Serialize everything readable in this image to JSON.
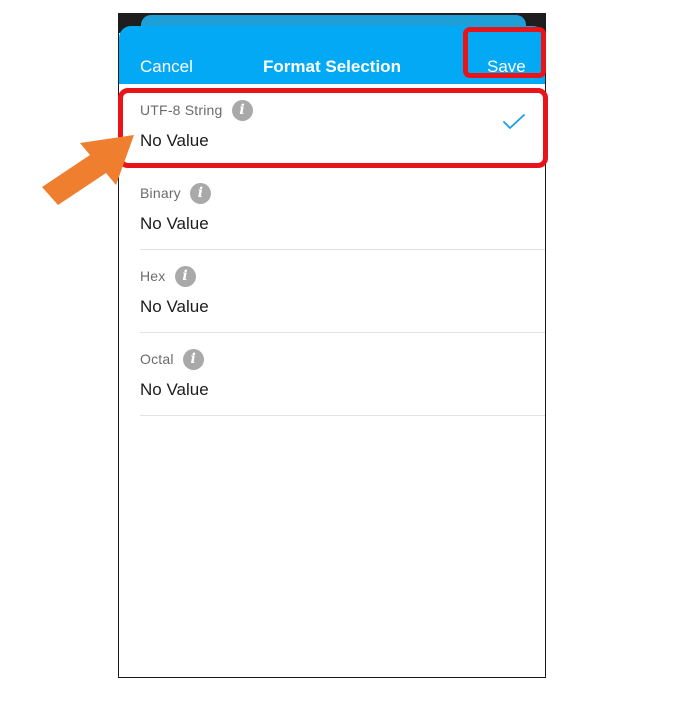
{
  "header": {
    "cancel_label": "Cancel",
    "title": "Format Selection",
    "save_label": "Save",
    "background_color": "#03a9f4"
  },
  "formats": [
    {
      "label": "UTF-8 String",
      "value": "No Value",
      "selected": true,
      "info_icon": "info-icon"
    },
    {
      "label": "Binary",
      "value": "No Value",
      "selected": false,
      "info_icon": "info-icon"
    },
    {
      "label": "Hex",
      "value": "No Value",
      "selected": false,
      "info_icon": "info-icon"
    },
    {
      "label": "Octal",
      "value": "No Value",
      "selected": false,
      "info_icon": "info-icon"
    }
  ],
  "selected_icon": "checkmark-icon",
  "annotations": {
    "highlight_color": "#e8141a",
    "arrow_color": "#ef7f2f",
    "arrow_icon": "arrow-icon"
  }
}
